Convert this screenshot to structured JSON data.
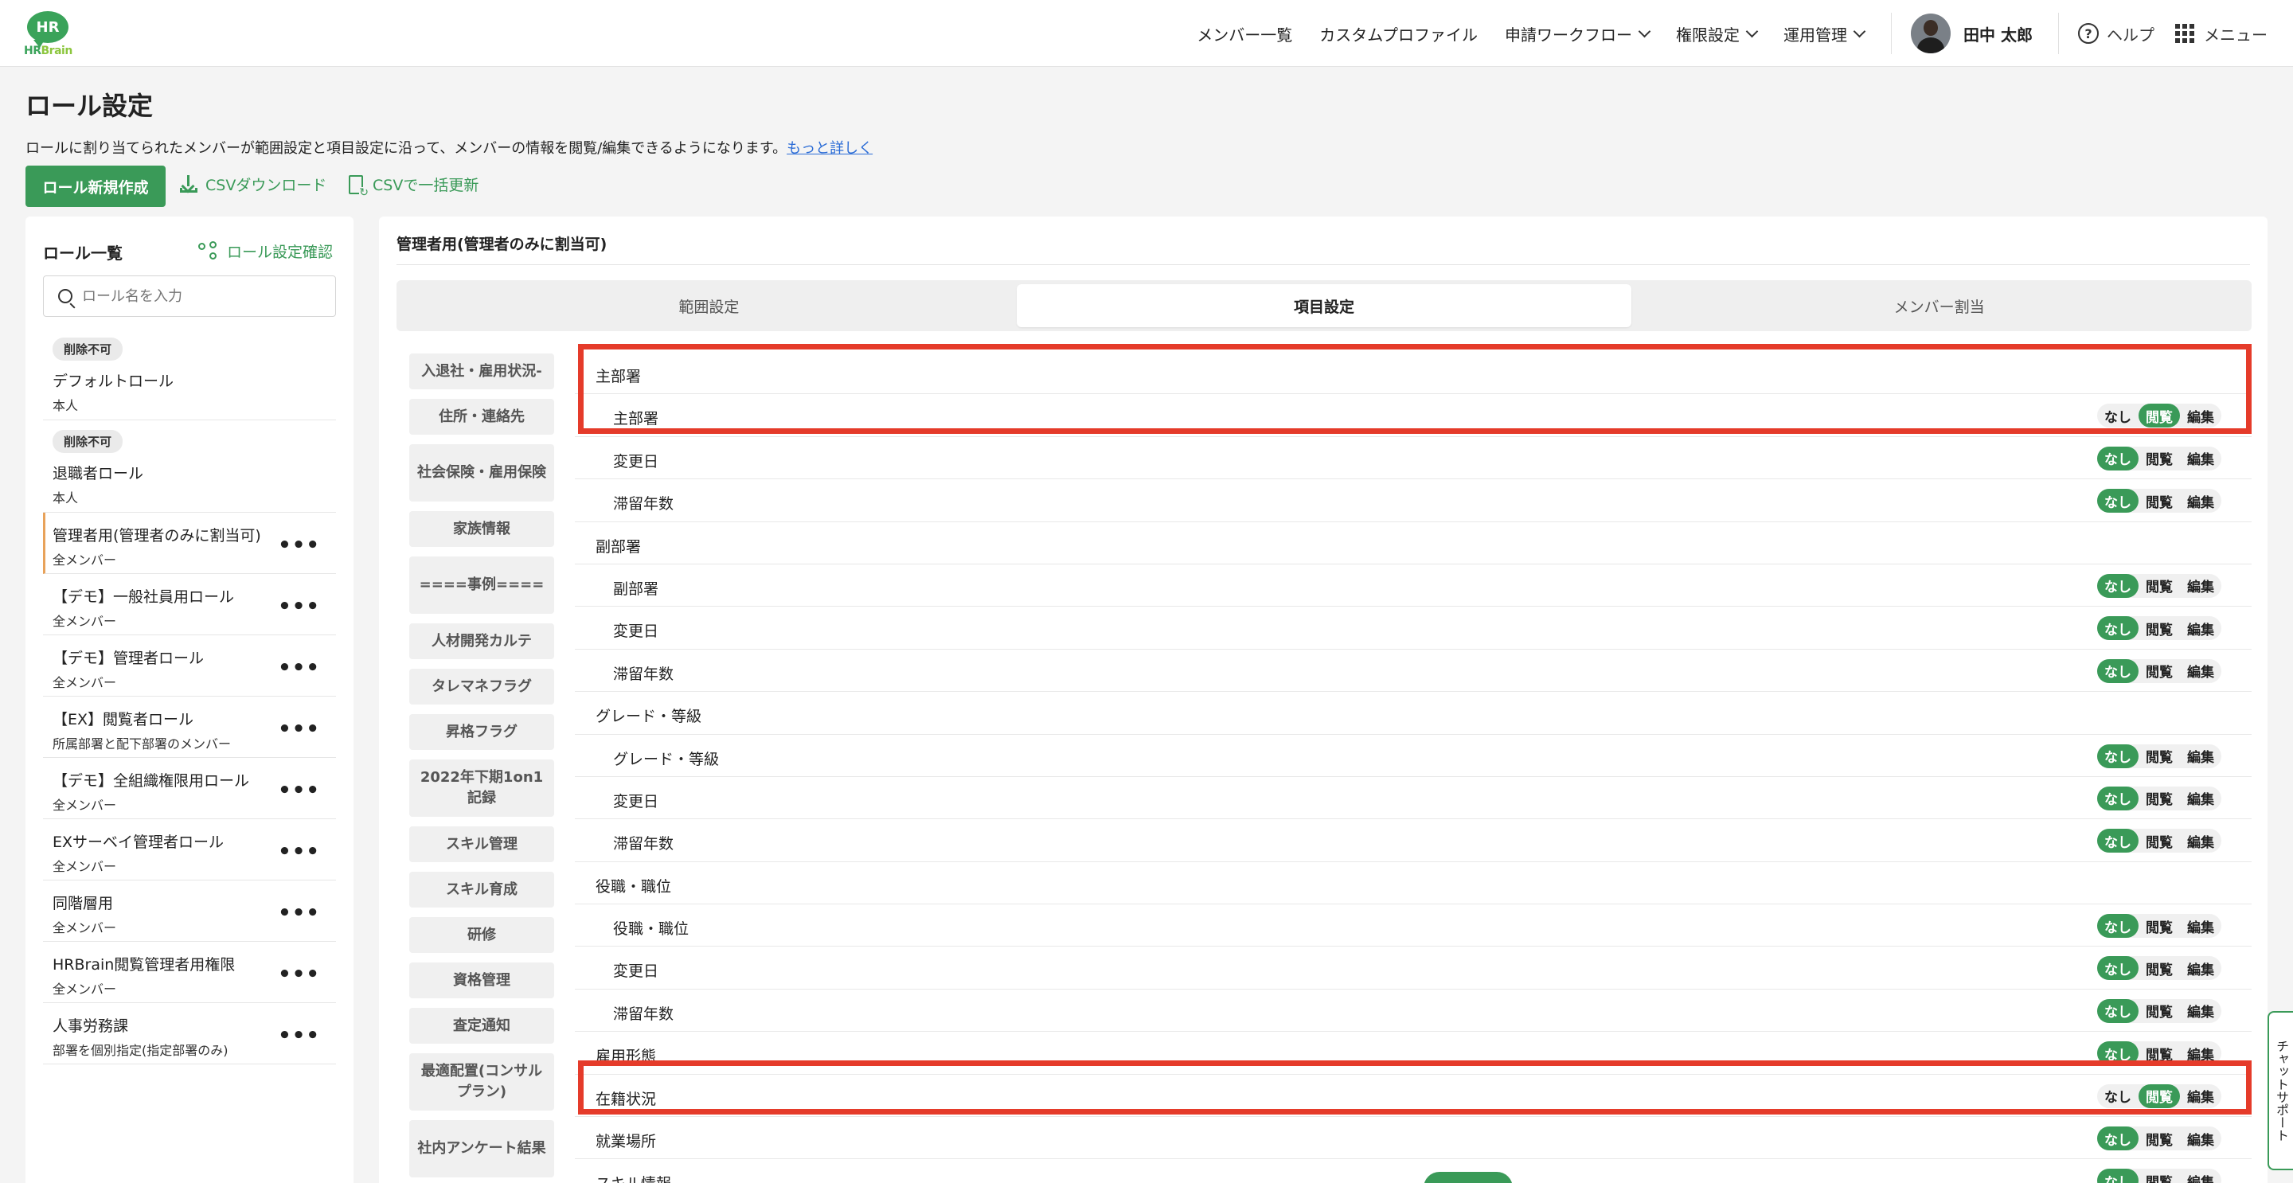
{
  "header": {
    "logo_mark": "HR",
    "logo_text_a": "HR",
    "logo_text_b": "Brain",
    "nav": [
      {
        "label": "メンバー一覧",
        "dropdown": false
      },
      {
        "label": "カスタムプロファイル",
        "dropdown": false
      },
      {
        "label": "申請ワークフロー",
        "dropdown": true
      },
      {
        "label": "権限設定",
        "dropdown": true
      },
      {
        "label": "運用管理",
        "dropdown": true
      }
    ],
    "user_name": "田中 太郎",
    "help_label": "ヘルプ",
    "menu_label": "メニュー"
  },
  "page": {
    "title": "ロール設定",
    "description": "ロールに割り当てられたメンバーが範囲設定と項目設定に沿って、メンバーの情報を閲覧/編集できるようになります。",
    "more_link": "もっと詳しく",
    "new_role_button": "ロール新規作成",
    "csv_download": "CSVダウンロード",
    "csv_update": "CSVで一括更新"
  },
  "role_panel": {
    "title": "ロール一覧",
    "check_link": "ロール設定確認",
    "search_placeholder": "ロール名を入力",
    "roles": [
      {
        "badge": "削除不可",
        "name": "デフォルトロール",
        "scope": "本人"
      },
      {
        "badge": "削除不可",
        "name": "退職者ロール",
        "scope": "本人"
      },
      {
        "name": "管理者用(管理者のみに割当可)",
        "scope": "全メンバー",
        "active": true
      },
      {
        "name": "【デモ】一般社員用ロール",
        "scope": "全メンバー"
      },
      {
        "name": "【デモ】管理者ロール",
        "scope": "全メンバー"
      },
      {
        "name": "【EX】閲覧者ロール",
        "scope": "所属部署と配下部署のメンバー"
      },
      {
        "name": "【デモ】全組織権限用ロール",
        "scope": "全メンバー"
      },
      {
        "name": "EXサーベイ管理者ロール",
        "scope": "全メンバー"
      },
      {
        "name": "同階層用",
        "scope": "全メンバー"
      },
      {
        "name": "HRBrain閲覧管理者用権限",
        "scope": "全メンバー"
      },
      {
        "name": "人事労務課",
        "scope": "部署を個別指定(指定部署のみ)"
      }
    ],
    "more_icon": "•••"
  },
  "detail": {
    "title": "管理者用(管理者のみに割当可)",
    "tabs": [
      {
        "label": "範囲設定",
        "active": false
      },
      {
        "label": "項目設定",
        "active": true
      },
      {
        "label": "メンバー割当",
        "active": false
      }
    ],
    "categories": [
      "入退社・雇用状況-",
      "住所・連絡先",
      "社会保険・雇用保険",
      "家族情報",
      "====事例====",
      "人材開発カルテ",
      "タレマネフラグ",
      "昇格フラグ",
      "2022年下期1on1記録",
      "スキル管理",
      "スキル育成",
      "研修",
      "資格管理",
      "査定通知",
      "最適配置(コンサルプラン)",
      "社内アンケート結果"
    ],
    "perm_labels": {
      "none": "なし",
      "view": "閲覧",
      "edit": "編集"
    },
    "fields": [
      {
        "label": "主部署",
        "type": "group"
      },
      {
        "label": "主部署",
        "type": "sub",
        "perm": "view"
      },
      {
        "label": "変更日",
        "type": "sub",
        "perm": "none"
      },
      {
        "label": "滞留年数",
        "type": "sub",
        "perm": "none"
      },
      {
        "label": "副部署",
        "type": "group"
      },
      {
        "label": "副部署",
        "type": "sub",
        "perm": "none"
      },
      {
        "label": "変更日",
        "type": "sub",
        "perm": "none"
      },
      {
        "label": "滞留年数",
        "type": "sub",
        "perm": "none"
      },
      {
        "label": "グレード・等級",
        "type": "group"
      },
      {
        "label": "グレード・等級",
        "type": "sub",
        "perm": "none"
      },
      {
        "label": "変更日",
        "type": "sub",
        "perm": "none"
      },
      {
        "label": "滞留年数",
        "type": "sub",
        "perm": "none"
      },
      {
        "label": "役職・職位",
        "type": "group"
      },
      {
        "label": "役職・職位",
        "type": "sub",
        "perm": "none"
      },
      {
        "label": "変更日",
        "type": "sub",
        "perm": "none"
      },
      {
        "label": "滞留年数",
        "type": "sub",
        "perm": "none"
      },
      {
        "label": "雇用形態",
        "type": "group",
        "perm": "none"
      },
      {
        "label": "在籍状況",
        "type": "group",
        "perm": "view"
      },
      {
        "label": "就業場所",
        "type": "group",
        "perm": "none"
      },
      {
        "label": "スキル情報",
        "type": "group",
        "perm": "none"
      }
    ]
  },
  "chat_support_label": "チャットサポート",
  "colors": {
    "brand_green": "#3a9a58",
    "highlight_red": "#e53b2a"
  }
}
